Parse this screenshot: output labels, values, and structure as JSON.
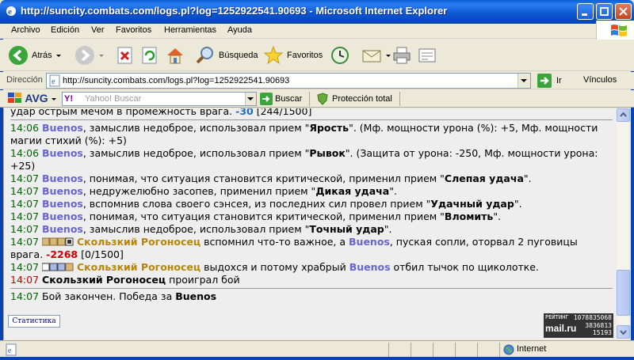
{
  "window": {
    "title": "http://suncity.combats.com/logs.pl?log=1252922541.90693 - Microsoft Internet Explorer"
  },
  "menu": [
    "Archivo",
    "Edición",
    "Ver",
    "Favoritos",
    "Herramientas",
    "Ayuda"
  ],
  "toolbar": {
    "back_label": "Atrás",
    "search_label": "Búsqueda",
    "favorites_label": "Favoritos"
  },
  "address": {
    "label": "Dirección",
    "url": "http://suncity.combats.com/logs.pl?log=1252922541.90693",
    "go_label": "Ir",
    "links_label": "Vínculos"
  },
  "avg": {
    "logo": "AVG",
    "search_placeholder": "Yahoo! Buscar",
    "search_button": "Buscar",
    "protection_label": "Protección total",
    "yahoo_mark": "Y!"
  },
  "log": {
    "partial_line": {
      "text": "удар острым мечом в промежность врага.",
      "damage": "-30",
      "hp": "[244/1500]"
    },
    "entries": [
      {
        "time": "14:06",
        "name": "Buenos",
        "pre": ", замыслив недоброе, использовал прием \"",
        "action": "Ярость",
        "post": "\". (Мф. мощности урона (%): +5, Мф. мощности магии стихий (%): +5)"
      },
      {
        "time": "14:06",
        "name": "Buenos",
        "pre": ", замыслив недоброе, использовал прием \"",
        "action": "Рывок",
        "post": "\". (Защита от урона: -250, Мф. мощности урона: +25)"
      },
      {
        "time": "14:07",
        "name": "Buenos",
        "pre": ", понимая, что ситуация становится критической, применил прием \"",
        "action": "Слепая удача",
        "post": "\"."
      },
      {
        "time": "14:07",
        "name": "Buenos",
        "pre": ", недружелюбно засопев, применил прием \"",
        "action": "Дикая удача",
        "post": "\"."
      },
      {
        "time": "14:07",
        "name": "Buenos",
        "pre": ", вспомнив слова своего сэнсея, из последних сил провел прием \"",
        "action": "Удачный удар",
        "post": "\"."
      },
      {
        "time": "14:07",
        "name": "Buenos",
        "pre": ", понимая, что ситуация становится критической, применил прием \"",
        "action": "Вломить",
        "post": "\"."
      },
      {
        "time": "14:07",
        "name": "Buenos",
        "pre": ", замыслив недоброе, использовал прием \"",
        "action": "Точный удар",
        "post": "\"."
      }
    ],
    "hit1": {
      "time": "14:07",
      "enemy": "Скользкий Рогоносец",
      "pre": " вспомнил что-то важное, а ",
      "name": "Buenos",
      "post": ", пуская сопли, оторвал 2 пуговицы врага.",
      "damage": "-2268",
      "hp": "[0/1500]"
    },
    "hit2": {
      "time": "14:07",
      "enemy": "Скользкий Рогоносец",
      "pre": " выдохся и потому храбрый ",
      "name": "Buenos",
      "post": " отбил тычок по щиколотке."
    },
    "lost": {
      "time": "14:07",
      "enemy": "Скользкий Рогоносец",
      "text": " проиграл бой"
    },
    "end": {
      "time": "14:07",
      "text": "Бой закончен. Победа за ",
      "winner": "Buenos"
    }
  },
  "footer": {
    "stats_button": "Статистика",
    "counter_brand": "mail.ru",
    "counter_label": "РЕЙТИНГ",
    "counter_values": [
      "1078835068",
      "3836813",
      "15193"
    ]
  },
  "status": {
    "zone": "Internet"
  }
}
